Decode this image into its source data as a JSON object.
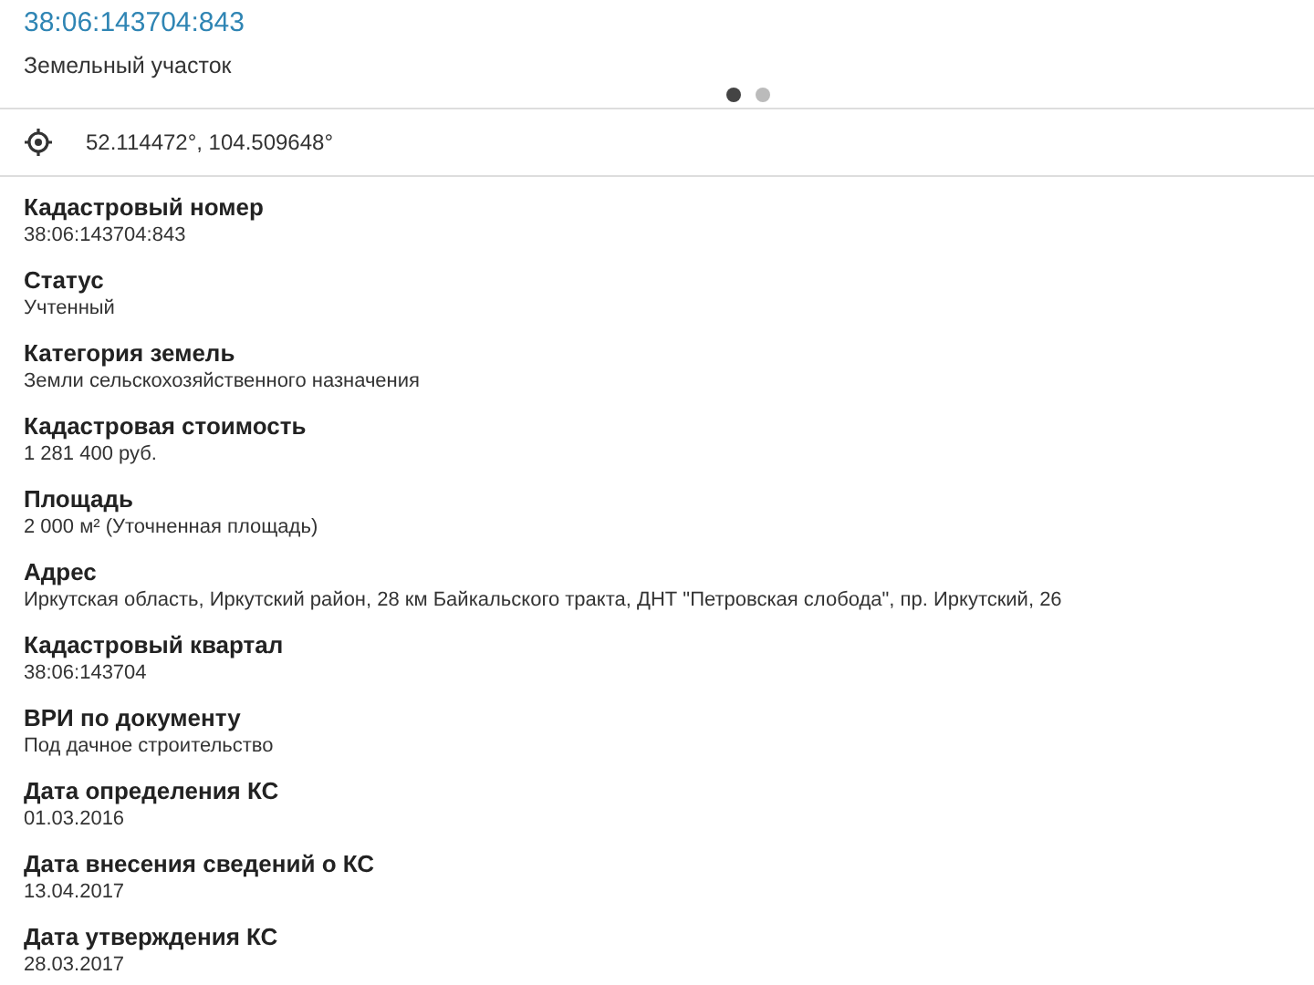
{
  "header": {
    "title": "38:06:143704:843",
    "subtitle": "Земельный участок"
  },
  "pager": [
    {
      "selected": true
    },
    {
      "selected": false
    }
  ],
  "location": {
    "coordinates": "52.114472°, 104.509648°"
  },
  "fields": [
    {
      "label": "Кадастровый номер",
      "value": "38:06:143704:843"
    },
    {
      "label": "Статус",
      "value": "Учтенный"
    },
    {
      "label": "Категория земель",
      "value": "Земли сельскохозяйственного назначения"
    },
    {
      "label": "Кадастровая стоимость",
      "value": "1 281 400 руб."
    },
    {
      "label": "Площадь",
      "value": "2 000 м² (Уточненная площадь)"
    },
    {
      "label": "Адрес",
      "value": "Иркутская область, Иркутский район, 28 км Байкальского тракта, ДНТ \"Петровская слобода\", пр. Иркутский, 26"
    },
    {
      "label": "Кадастровый квартал",
      "value": "38:06:143704"
    },
    {
      "label": "ВРИ по документу",
      "value": "Под дачное строительство"
    },
    {
      "label": "Дата определения КС",
      "value": "01.03.2016"
    },
    {
      "label": "Дата внесения сведений о КС",
      "value": "13.04.2017"
    },
    {
      "label": "Дата утверждения КС",
      "value": "28.03.2017"
    }
  ]
}
